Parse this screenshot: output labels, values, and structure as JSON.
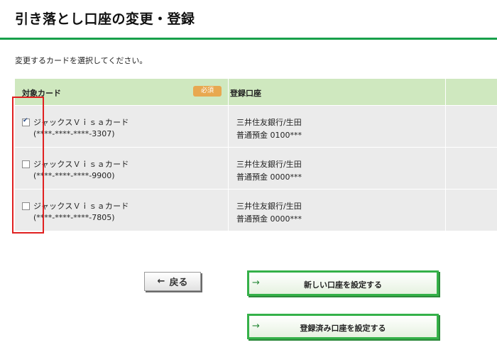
{
  "page": {
    "title": "引き落とし口座の変更・登録",
    "instruction": "変更するカードを選択してください。"
  },
  "table": {
    "headers": {
      "card": "対象カード",
      "required_badge": "必須",
      "account": "登録口座"
    },
    "rows": [
      {
        "checked": true,
        "card_name": "ジャックスＶｉｓａカード",
        "card_number": "(****-****-****-3307)",
        "bank": "三井住友銀行/生田",
        "account": "普通預金 0100***"
      },
      {
        "checked": false,
        "card_name": "ジャックスＶｉｓａカード",
        "card_number": "(****-****-****-9900)",
        "bank": "三井住友銀行/生田",
        "account": "普通預金 0000***"
      },
      {
        "checked": false,
        "card_name": "ジャックスＶｉｓａカード",
        "card_number": "(****-****-****-7805)",
        "bank": "三井住友銀行/生田",
        "account": "普通預金 0000***"
      }
    ]
  },
  "buttons": {
    "back_arrow": "←",
    "back": "戻る",
    "arrow": "→",
    "new_account": "新しい口座を設定する",
    "registered_account": "登録済み口座を設定する"
  },
  "colors": {
    "accent_green": "#17a04a",
    "header_bg": "#cfe8bf",
    "row_bg": "#ebebeb",
    "badge": "#e8a850",
    "highlight_red": "#e02020"
  }
}
